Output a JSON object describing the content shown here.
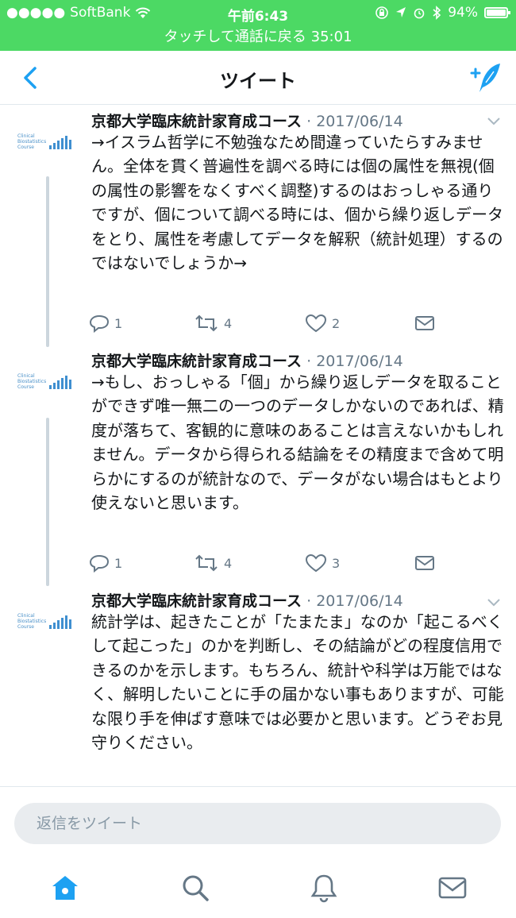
{
  "status_bar": {
    "carrier": "SoftBank",
    "time": "午前6:43",
    "battery": "94%"
  },
  "call_banner": {
    "text": "タッチして通話に戻る 35:01"
  },
  "nav": {
    "title": "ツイート"
  },
  "tweets": [
    {
      "name": "京都大学臨床統計家育成コース",
      "separator": "·",
      "date": "2017/06/14",
      "text": "→イスラム哲学に不勉強なため間違っていたらすみません。全体を貫く普遍性を調べる時には個の属性を無視(個の属性の影響をなくすべく調整)するのはおっしゃる通りですが、個について調べる時には、個から繰り返しデータをとり、属性を考慮してデータを解釈（統計処理）するのではないでしょうか→",
      "replies": "1",
      "retweets": "4",
      "likes": "2"
    },
    {
      "name": "京都大学臨床統計家育成コース",
      "separator": "·",
      "date": "2017/06/14",
      "text": "→もし、おっしゃる「個」から繰り返しデータを取ることができず唯一無二の一つのデータしかないのであれば、精度が落ちて、客観的に意味のあることは言えないかもしれません。データから得られる結論をその精度まで含めて明らかにするのが統計なので、データがない場合はもとより使えないと思います。",
      "replies": "1",
      "retweets": "4",
      "likes": "3"
    },
    {
      "name": "京都大学臨床統計家育成コース",
      "separator": "·",
      "date": "2017/06/14",
      "text": "統計学は、起きたことが「たまたま」なのか「起こるべくして起こった」のかを判断し、その結論がどの程度信用できるのかを示します。もちろん、統計や科学は万能ではなく、解明したいことに手の届かない事もありますが、可能な限り手を伸ばす意味では必要かと思います。どうぞお見守りください。"
    }
  ],
  "reply": {
    "placeholder": "返信をツイート"
  },
  "colors": {
    "status_green": "#4cd964",
    "twitter_blue": "#1da1f2",
    "gray_text": "#657786"
  }
}
